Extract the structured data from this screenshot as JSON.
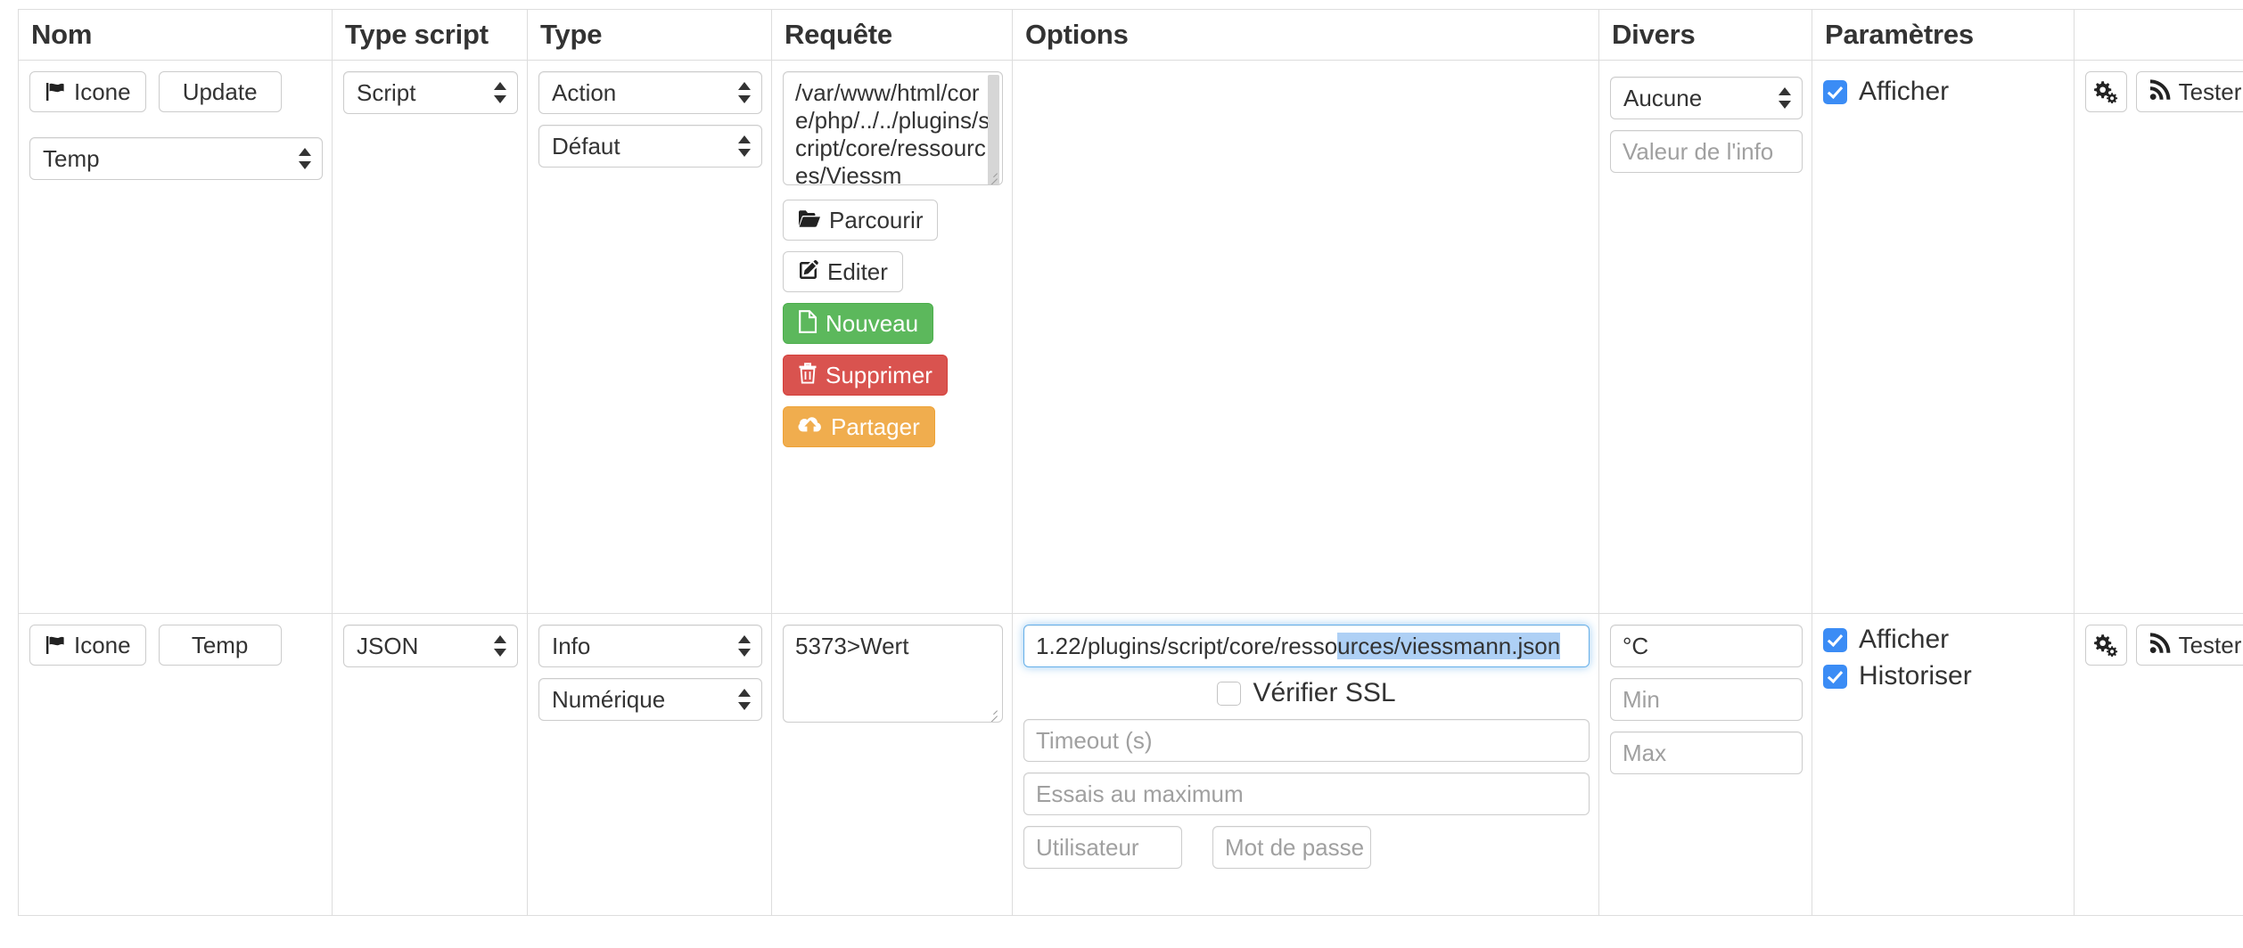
{
  "table": {
    "columns": [
      {
        "key": "nom",
        "label": "Nom"
      },
      {
        "key": "typescript",
        "label": "Type script"
      },
      {
        "key": "type",
        "label": "Type"
      },
      {
        "key": "requete",
        "label": "Requête"
      },
      {
        "key": "options",
        "label": "Options"
      },
      {
        "key": "divers",
        "label": "Divers"
      },
      {
        "key": "params",
        "label": "Paramètres"
      },
      {
        "key": "actions",
        "label": ""
      }
    ]
  },
  "colors": {
    "success_green": "#5cb85c",
    "danger_red": "#d9534f",
    "warning_orange": "#f0ad4e",
    "checkbox_blue": "#3b8cf5",
    "focus_blue": "#66afe9",
    "selection_blue": "#aed0f5",
    "border_grey": "#dddddd"
  },
  "rows": [
    {
      "nom": {
        "icon_button_label": "Icone",
        "name_value": "Update",
        "subtype_select_value": "Temp"
      },
      "typescript": {
        "select_value": "Script"
      },
      "type": {
        "type_select_value": "Action",
        "subtype_select_value": "Défaut"
      },
      "requete": {
        "textarea_value": "/var/www/html/core/php/../../plugins/script/core/ressources/Viessm",
        "buttons": [
          {
            "name": "browse",
            "label": "Parcourir",
            "style": "default"
          },
          {
            "name": "edit",
            "label": "Editer",
            "style": "default"
          },
          {
            "name": "new",
            "label": "Nouveau",
            "style": "green"
          },
          {
            "name": "delete",
            "label": "Supprimer",
            "style": "red"
          },
          {
            "name": "share",
            "label": "Partager",
            "style": "orange"
          }
        ]
      },
      "options": {},
      "divers": {
        "select_value": "Aucune",
        "info_value_placeholder": "Valeur de l'info"
      },
      "params": {
        "checkboxes": [
          {
            "label": "Afficher",
            "checked": true
          }
        ]
      },
      "actions": {
        "config_icon": "gears-icon",
        "test_label": "Tester",
        "duplicate_icon": "copy-icon",
        "remove_icon": "minus-circle-icon"
      }
    },
    {
      "nom": {
        "icon_button_label": "Icone",
        "name_value": "Temp"
      },
      "typescript": {
        "select_value": "JSON"
      },
      "type": {
        "type_select_value": "Info",
        "subtype_select_value": "Numérique"
      },
      "requete": {
        "textarea_value": "5373>Wert"
      },
      "options": {
        "url_value_prefix": "1.22/plugins/script/core/resso",
        "url_value_selected": "urces/viessmann.json",
        "ssl_checkbox_label": "Vérifier SSL",
        "ssl_checked": false,
        "timeout_placeholder": "Timeout (s)",
        "retries_placeholder": "Essais au maximum",
        "user_placeholder": "Utilisateur",
        "password_placeholder": "Mot de passe"
      },
      "divers": {
        "unit_value": "°C",
        "min_placeholder": "Min",
        "max_placeholder": "Max"
      },
      "params": {
        "checkboxes": [
          {
            "label": "Afficher",
            "checked": true
          },
          {
            "label": "Historiser",
            "checked": true
          }
        ]
      },
      "actions": {
        "config_icon": "gears-icon",
        "test_label": "Tester",
        "duplicate_icon": "copy-icon",
        "remove_icon": "minus-circle-icon"
      }
    }
  ]
}
